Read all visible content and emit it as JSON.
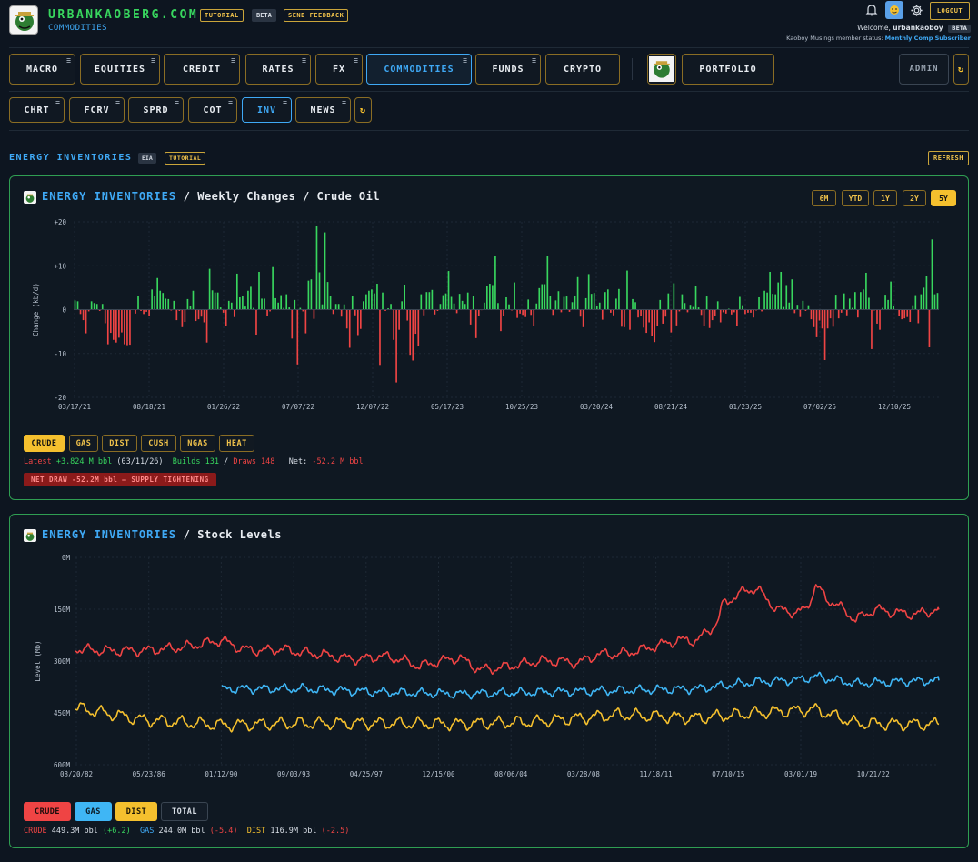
{
  "header": {
    "site_title": "URBANKAOBERG.COM",
    "site_subtitle": "COMMODITIES",
    "tutorial_chip": "TUTORIAL",
    "beta_chip": "BETA",
    "feedback_chip": "SEND FEEDBACK",
    "logout": "LOGOUT",
    "welcome_prefix": "Welcome, ",
    "username": "urbankaoboy",
    "user_beta": "BETA",
    "member_prefix": "Kaoboy Musings member status: ",
    "member_status": "Monthly Comp Subscriber"
  },
  "nav": {
    "items": [
      {
        "label": "MACRO",
        "active": false
      },
      {
        "label": "EQUITIES",
        "active": false
      },
      {
        "label": "CREDIT",
        "active": false
      },
      {
        "label": "RATES",
        "active": false
      },
      {
        "label": "FX",
        "active": false
      },
      {
        "label": "COMMODITIES",
        "active": true
      },
      {
        "label": "FUNDS",
        "active": false
      },
      {
        "label": "CRYPTO",
        "active": false
      }
    ],
    "portfolio": "PORTFOLIO",
    "admin": "ADMIN",
    "refresh_icon": "↻"
  },
  "subnav": {
    "items": [
      {
        "label": "CHRT",
        "active": false
      },
      {
        "label": "FCRV",
        "active": false
      },
      {
        "label": "SPRD",
        "active": false
      },
      {
        "label": "COT",
        "active": false
      },
      {
        "label": "INV",
        "active": true
      },
      {
        "label": "NEWS",
        "active": false
      }
    ],
    "refresh_icon": "↻"
  },
  "section": {
    "title": "ENERGY INVENTORIES",
    "source_chip": "EIA",
    "tutorial_chip": "TUTORIAL",
    "refresh": "REFRESH"
  },
  "weekly_panel": {
    "title_blue": "ENERGY INVENTORIES",
    "title_rest": " / Weekly Changes / Crude Oil",
    "ranges": [
      {
        "label": "6M",
        "active": false
      },
      {
        "label": "YTD",
        "active": false
      },
      {
        "label": "1Y",
        "active": false
      },
      {
        "label": "2Y",
        "active": false
      },
      {
        "label": "5Y",
        "active": true
      }
    ],
    "series_buttons": [
      {
        "label": "CRUDE",
        "active": true
      },
      {
        "label": "GAS",
        "active": false
      },
      {
        "label": "DIST",
        "active": false
      },
      {
        "label": "CUSH",
        "active": false
      },
      {
        "label": "NGAS",
        "active": false
      },
      {
        "label": "HEAT",
        "active": false
      }
    ],
    "stats": {
      "latest_label": "Latest ",
      "latest_value": "+3.824 M bbl",
      "latest_date": " (03/11/26)",
      "builds": "Builds 131",
      "sep": " / ",
      "draws": "Draws 148",
      "net_label": "Net: ",
      "net_value": "-52.2 M bbl"
    },
    "alert": "NET DRAW -52.2M bbl — SUPPLY TIGHTENING"
  },
  "stock_panel": {
    "title_blue": "ENERGY INVENTORIES",
    "title_rest": " / Stock Levels",
    "legend_buttons": [
      {
        "label": "CRUDE",
        "bg": "#ef4444",
        "fg": "#1a0c0c"
      },
      {
        "label": "GAS",
        "bg": "#3fb6f5",
        "fg": "#0c1a24"
      },
      {
        "label": "DIST",
        "bg": "#f5c02e",
        "fg": "#1a1405"
      },
      {
        "label": "TOTAL",
        "bg": "#131c27",
        "fg": "#d8dee6"
      }
    ],
    "summary": {
      "crude_label": "CRUDE ",
      "crude_value": "449.3M bbl ",
      "crude_change": "(+6.2)",
      "gas_label": "GAS ",
      "gas_value": "244.0M bbl ",
      "gas_change": "(-5.4)",
      "dist_label": "DIST ",
      "dist_value": "116.9M bbl ",
      "dist_change": "(-2.5)"
    }
  },
  "colors": {
    "build": "#38d65e",
    "draw": "#ef4444",
    "crude": "#ef4444",
    "gas": "#3fb6f5",
    "dist": "#f5c02e",
    "accent": "#3fa9f5",
    "panel_border": "#2f9e52"
  },
  "chart_data": [
    {
      "type": "bar",
      "title": "Weekly Changes / Crude Oil",
      "ylabel": "Change (kb/d)",
      "ylim": [
        -20,
        20
      ],
      "yticks": [
        "+20",
        "+10",
        "0",
        "-10",
        "-20"
      ],
      "x_tick_labels": [
        "03/17/21",
        "08/18/21",
        "01/26/22",
        "07/07/22",
        "12/07/22",
        "05/17/23",
        "10/25/23",
        "03/20/24",
        "08/21/24",
        "01/23/25",
        "07/02/25",
        "12/10/25"
      ],
      "values": [
        2.1,
        1.9,
        -1.0,
        -2.4,
        -5.4,
        -0.4,
        1.9,
        1.5,
        1.3,
        -0.3,
        1.3,
        -3.1,
        -7.9,
        -5.3,
        -6.9,
        -7.5,
        -6.4,
        -5.2,
        -7.9,
        -8.1,
        -8.0,
        0.1,
        -0.9,
        3.1,
        -0.3,
        -1.0,
        -0.5,
        -1.5,
        4.6,
        3.2,
        7.2,
        4.3,
        3.8,
        2.5,
        2.4,
        -0.2,
        2.0,
        -2.4,
        -0.3,
        -4.0,
        -2.8,
        2.4,
        0.8,
        4.3,
        -2.6,
        -2.2,
        -1.6,
        -2.9,
        -7.5,
        9.3,
        4.4,
        3.9,
        3.9,
        0.5,
        -0.7,
        -3.7,
        2.0,
        1.6,
        -1.7,
        8.2,
        2.8,
        3.1,
        0.7,
        4.3,
        5.2,
        0.4,
        -5.7,
        8.6,
        2.5,
        2.5,
        -1.4,
        -0.4,
        9.7,
        2.6,
        1.6,
        3.3,
        0.4,
        3.5,
        0.5,
        -6.6,
        2.2,
        -12.5,
        0.4,
        -0.4,
        -5.4,
        6.6,
        6.9,
        -2.1,
        19.0,
        8.5,
        1.2,
        17.6,
        6.3,
        3.1,
        -1.0,
        1.3,
        1.3,
        -1.6,
        1.2,
        -4.3,
        -8.7,
        3.2,
        -1.3,
        -5.8,
        -4.4,
        1.9,
        3.5,
        4.3,
        4.6,
        3.7,
        5.9,
        -12.6,
        3.9,
        -0.3,
        0.3,
        1.3,
        -6.9,
        -16.6,
        -4.6,
        1.9,
        5.7,
        -2.5,
        -10.3,
        -11.6,
        -5.5,
        -8.3,
        3.5,
        -1.3,
        4.0,
        4.0,
        4.5,
        -1.1,
        -0.3,
        1.3,
        3.3,
        3.7,
        8.8,
        2.9,
        1.4,
        -0.8,
        3.6,
        2.0,
        1.3,
        3.9,
        -3.4,
        3.2,
        -6.5,
        -1.5,
        -0.1,
        1.6,
        5.4,
        5.9,
        5.6,
        12.2,
        1.5,
        -4.9,
        -1.4,
        2.8,
        1.2,
        -0.2,
        6.2,
        -1.9,
        -0.9,
        -1.2,
        -1.7,
        2.3,
        -1.2,
        -3.7,
        1.4,
        4.9,
        5.8,
        5.8,
        12.2,
        3.2,
        -1.2,
        2.1,
        4.2,
        -0.6,
        2.9,
        3.0,
        -0.5,
        1.7,
        3.2,
        7.4,
        -1.6,
        -4.0,
        2.6,
        8.1,
        3.6,
        3.8,
        0.8,
        1.6,
        -2.3,
        4.0,
        4.6,
        -0.7,
        -1.3,
        2.5,
        4.7,
        -3.9,
        -4.0,
        8.9,
        -4.6,
        2.4,
        1.7,
        -1.8,
        -1.5,
        -4.1,
        -5.3,
        -2.9,
        -6.1,
        -7.4,
        -3.7,
        2.2,
        -3.2,
        -1.6,
        3.7,
        -5.2,
        6.0,
        -3.6,
        -0.4,
        3.5,
        1.5,
        -0.6,
        1.1,
        0.6,
        5.3,
        0.5,
        -1.2,
        -3.8,
        3.0,
        -4.2,
        -2.4,
        -1.4,
        1.9,
        -2.9,
        -0.6,
        -0.9,
        0.2,
        -1.1,
        -0.6,
        -3.7,
        2.9,
        1.0,
        -1.0,
        -0.7,
        -0.7,
        -1.8,
        -0.2,
        2.8,
        -0.4,
        4.3,
        3.9,
        8.6,
        3.6,
        3.5,
        6.2,
        8.6,
        0.6,
        5.6,
        1.6,
        6.9,
        -0.8,
        1.1,
        -1.7,
        2.0,
        -0.3,
        1.0,
        -2.2,
        -4.0,
        -6.3,
        -2.5,
        -4.3,
        -11.5,
        -4.3,
        -2.0,
        -3.9,
        3.4,
        -2.0,
        -0.7,
        3.7,
        -1.3,
        2.5,
        0.4,
        4.0,
        -1.8,
        4.0,
        4.6,
        8.4,
        2.7,
        -9.0,
        -0.2,
        -3.2,
        -4.6,
        0.4,
        3.4,
        2.2,
        6.4,
        0.9,
        0.1,
        -1.5,
        -2.2,
        -2.0,
        -1.7,
        -2.8,
        1.0,
        3.3,
        -3.1,
        3.5,
        5.0,
        7.6,
        -8.6,
        16.0,
        3.5,
        3.8
      ],
      "builds": 131,
      "draws": 148,
      "net": -52.2
    },
    {
      "type": "line",
      "title": "Stock Levels",
      "ylabel": "Level (Mb)",
      "ylim": [
        0,
        600
      ],
      "yticks": [
        "0M",
        "150M",
        "300M",
        "450M",
        "600M"
      ],
      "x_tick_labels": [
        "08/20/82",
        "05/23/86",
        "01/12/90",
        "09/03/93",
        "04/25/97",
        "12/15/00",
        "08/06/04",
        "03/28/08",
        "11/18/11",
        "07/10/15",
        "03/01/19",
        "10/21/22"
      ],
      "x_range": [
        "1982-08-20",
        "2026-03-11"
      ],
      "series": [
        {
          "name": "CRUDE",
          "start_year": 1982.6,
          "end_year": 2026.2,
          "years": [
            1982.6,
            1984,
            1986,
            1988,
            1990,
            1991,
            1992,
            1993,
            1994,
            1995,
            1996,
            1997,
            1998,
            1999,
            2000,
            2001,
            2002,
            2003,
            2004,
            2005,
            2006,
            2007,
            2008,
            2009,
            2010,
            2011,
            2012,
            2013,
            2014,
            2015,
            2015.3,
            2016,
            2016.5,
            2017,
            2018,
            2019,
            2019.5,
            2020,
            2020.5,
            2021,
            2022,
            2023,
            2024,
            2025,
            2026.2
          ],
          "values": [
            335,
            330,
            330,
            340,
            360,
            335,
            330,
            335,
            325,
            320,
            310,
            305,
            315,
            305,
            285,
            300,
            310,
            275,
            280,
            290,
            300,
            300,
            295,
            320,
            320,
            330,
            345,
            360,
            360,
            410,
            465,
            490,
            505,
            510,
            450,
            440,
            450,
            520,
            480,
            465,
            420,
            450,
            440,
            435,
            449
          ]
        },
        {
          "name": "GAS",
          "start_year": 1990.0,
          "end_year": 2026.2,
          "years": [
            1990,
            1994,
            1998,
            2002,
            2006,
            2010,
            2014,
            2017,
            2019,
            2020,
            2022,
            2024,
            2026.2
          ],
          "values": [
            220,
            220,
            210,
            205,
            210,
            215,
            220,
            240,
            245,
            255,
            235,
            240,
            244
          ]
        },
        {
          "name": "DIST",
          "start_year": 1982.6,
          "end_year": 2026.2,
          "years": [
            1982.6,
            1986,
            1990,
            1994,
            1998,
            2002,
            2006,
            2010,
            2014,
            2017,
            2020,
            2022,
            2024,
            2026.2
          ],
          "values": [
            165,
            130,
            115,
            120,
            120,
            118,
            125,
            145,
            135,
            150,
            160,
            120,
            118,
            117
          ]
        }
      ],
      "summary": [
        {
          "name": "CRUDE",
          "level": 449.3,
          "change": 6.2
        },
        {
          "name": "GAS",
          "level": 244.0,
          "change": -5.4
        },
        {
          "name": "DIST",
          "level": 116.9,
          "change": -2.5
        }
      ]
    }
  ]
}
